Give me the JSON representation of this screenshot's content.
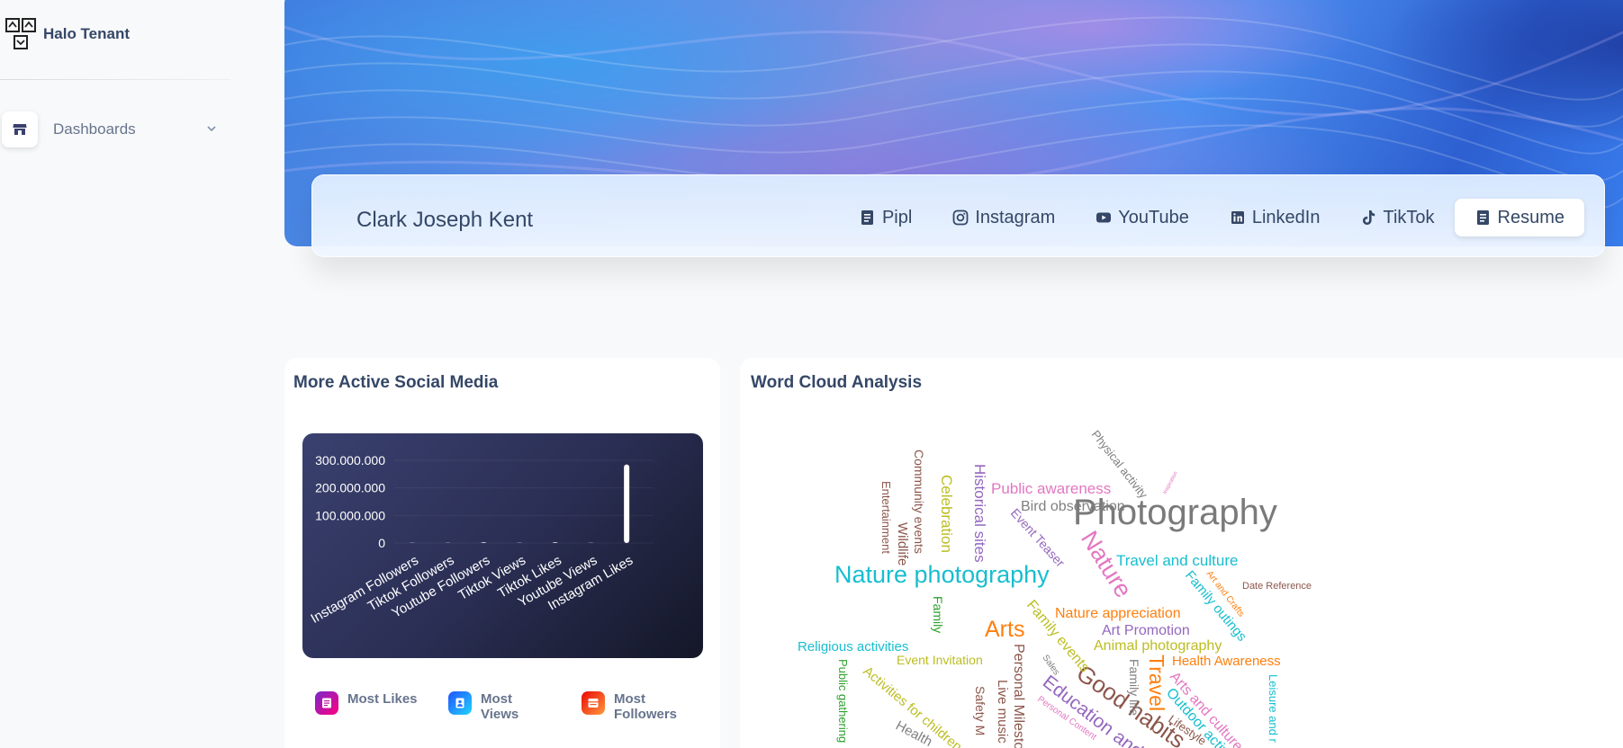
{
  "brand": {
    "name": "Halo Tenant"
  },
  "sidebar": {
    "items": [
      {
        "label": "Dashboards",
        "icon": "shop-icon"
      }
    ]
  },
  "profile": {
    "name": "Clark Joseph Kent",
    "tabs": [
      {
        "label": "Pipl",
        "icon": "document-icon",
        "active": false
      },
      {
        "label": "Instagram",
        "icon": "instagram-icon",
        "active": false
      },
      {
        "label": "YouTube",
        "icon": "youtube-icon",
        "active": false
      },
      {
        "label": "LinkedIn",
        "icon": "linkedin-icon",
        "active": false
      },
      {
        "label": "TikTok",
        "icon": "tiktok-icon",
        "active": false
      },
      {
        "label": "Resume",
        "icon": "document-icon",
        "active": true
      }
    ]
  },
  "social_card": {
    "title": "More Active Social Media",
    "legend": [
      {
        "label": "Most Likes",
        "icon": "likes-icon",
        "color_from": "#7928ca",
        "color_to": "#ff0080"
      },
      {
        "label": "Most Views",
        "icon": "user-icon",
        "color_from": "#2152ff",
        "color_to": "#21d4fd"
      },
      {
        "label": "Most Followers",
        "icon": "followers-icon",
        "color_from": "#ea0606",
        "color_to": "#ff9a3c"
      }
    ]
  },
  "cloud_card": {
    "title": "Word Cloud Analysis"
  },
  "chart_data": {
    "type": "bar",
    "categories": [
      "Instagram Followers",
      "Tiktok Followers",
      "Youtube Followers",
      "Tiktok Views",
      "Tiktok Likes",
      "Youtube Views",
      "Instagram Likes"
    ],
    "values": [
      0,
      0,
      900000,
      0,
      1200000,
      0,
      285000000
    ],
    "ylim": [
      0,
      300000000
    ],
    "yticks": [
      "300.000.000",
      "200.000.000",
      "100.000.000",
      "0"
    ],
    "ytick_values": [
      300000000,
      200000000,
      100000000,
      0
    ],
    "bar_color": "#ffffff"
  },
  "word_cloud": {
    "words": [
      {
        "text": "Photography",
        "color": "#7a7a7a"
      },
      {
        "text": "Nature photography",
        "color": "#17becf"
      },
      {
        "text": "Nature",
        "color": "#e377c2"
      },
      {
        "text": "Arts",
        "color": "#ff7f0e"
      },
      {
        "text": "Good habits",
        "color": "#8c564b"
      },
      {
        "text": "Travel",
        "color": "#ff7f0e"
      },
      {
        "text": "Education and",
        "color": "#9467bd"
      },
      {
        "text": "Public awareness",
        "color": "#e377c2"
      },
      {
        "text": "Bird observation",
        "color": "#7f7f7f"
      },
      {
        "text": "Travel and culture",
        "color": "#17becf"
      },
      {
        "text": "Nature appreciation",
        "color": "#ff7f0e"
      },
      {
        "text": "Art Promotion",
        "color": "#9467bd"
      },
      {
        "text": "Animal photography",
        "color": "#bcbd22"
      },
      {
        "text": "Health Awareness",
        "color": "#ff7f0e"
      },
      {
        "text": "Religious activities",
        "color": "#17becf"
      },
      {
        "text": "Event Invitation",
        "color": "#bcbd22"
      },
      {
        "text": "Family outings",
        "color": "#17becf"
      },
      {
        "text": "Family events",
        "color": "#bcbd22"
      },
      {
        "text": "Historical sites",
        "color": "#9467bd"
      },
      {
        "text": "Celebration",
        "color": "#bcbd22"
      },
      {
        "text": "Community events",
        "color": "#8c564b"
      },
      {
        "text": "Wildlife",
        "color": "#8c564b"
      },
      {
        "text": "Entertainment",
        "color": "#8c564b"
      },
      {
        "text": "Physical activity",
        "color": "#7f7f7f"
      },
      {
        "text": "Event Teaser",
        "color": "#9467bd"
      },
      {
        "text": "Family",
        "color": "#2ca02c"
      },
      {
        "text": "Date Reference",
        "color": "#8c564b"
      },
      {
        "text": "Art and Crafts",
        "color": "#ff7f0e"
      },
      {
        "text": "Arts and culture",
        "color": "#e377c2"
      },
      {
        "text": "Outdoor activities",
        "color": "#17becf"
      },
      {
        "text": "Family life",
        "color": "#7f7f7f"
      },
      {
        "text": "Leisure and r",
        "color": "#17becf"
      },
      {
        "text": "Personal Milestones",
        "color": "#8c564b"
      },
      {
        "text": "Live music",
        "color": "#8c564b"
      },
      {
        "text": "Safety M",
        "color": "#8c564b"
      },
      {
        "text": "Public gathering",
        "color": "#2ca02c"
      },
      {
        "text": "Activities for children",
        "color": "#bcbd22"
      },
      {
        "text": "Health",
        "color": "#7f7f7f"
      },
      {
        "text": "Sales",
        "color": "#7f7f7f"
      },
      {
        "text": "Personal Content",
        "color": "#e377c2"
      },
      {
        "text": "Lifestyle",
        "color": "#8c564b"
      },
      {
        "text": "Inspiration",
        "color": "#e377c2"
      }
    ]
  }
}
